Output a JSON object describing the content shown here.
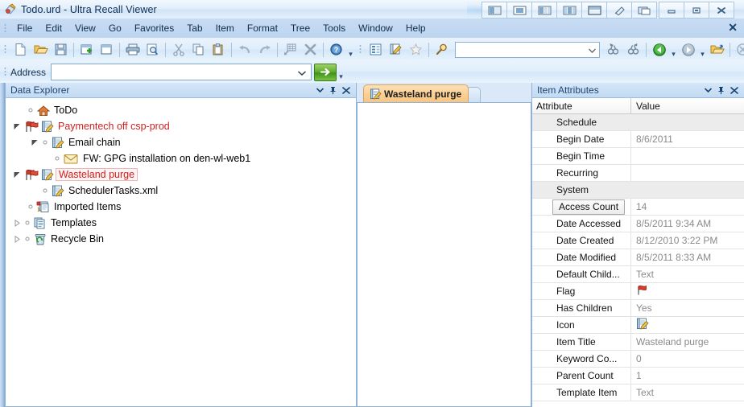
{
  "window": {
    "title": "Todo.urd - Ultra Recall Viewer",
    "app_icon": "ultra-recall-icon",
    "layout_buttons": [
      "layout-split-left",
      "layout-center",
      "layout-split-right",
      "layout-three-pane",
      "layout-horizontal",
      "layout-pin",
      "layout-float"
    ],
    "controls": {
      "minimize": "minimize-icon",
      "restore": "restore-icon",
      "close": "close-icon"
    }
  },
  "menu": {
    "items": [
      "File",
      "Edit",
      "View",
      "Go",
      "Favorites",
      "Tab",
      "Item",
      "Format",
      "Tree",
      "Tools",
      "Window",
      "Help"
    ],
    "close_label": "✕"
  },
  "toolbar": {
    "group1": [
      "new-document-icon",
      "open-folder-icon",
      "save-icon",
      "new-item-icon",
      "new-child-item-icon",
      "print-icon",
      "print-preview-icon",
      "cut-icon",
      "copy-icon",
      "paste-icon",
      "undo-icon",
      "redo-icon",
      "insert-item-icon",
      "delete-icon",
      "help-icon"
    ],
    "group2": [
      "outline-view-icon",
      "edit-note-icon",
      "favorites-star-icon",
      "find-icon"
    ],
    "search": {
      "value": "",
      "placeholder": ""
    },
    "group3": [
      "find-previous-icon",
      "find-next-icon",
      "back-icon",
      "back-dropdown-icon",
      "forward-icon",
      "forward-dropdown-icon",
      "go-up-folder-icon",
      "stop-icon",
      "refresh-icon",
      "view-mode-icon",
      "view-mode-dropdown-icon",
      "properties-grid-icon"
    ]
  },
  "address": {
    "label": "Address",
    "value": "",
    "placeholder": "",
    "dropdown_icon": "chevron-down-icon",
    "go_icon": "go-arrow-icon"
  },
  "explorer": {
    "title": "Data Explorer",
    "tools": [
      "chevron-down-icon",
      "pin-icon",
      "close-icon"
    ],
    "nodes": [
      {
        "label": "ToDo",
        "indent": 0,
        "icon": "home-icon",
        "expander": "none",
        "color": "normal",
        "selected": false,
        "dot": true
      },
      {
        "label": "Paymentech off csp-prod",
        "indent": 0,
        "icon": "note-edit-icon",
        "expander": "expanded",
        "color": "red",
        "selected": false,
        "dot": false,
        "flag": true
      },
      {
        "label": "Email chain",
        "indent": 1,
        "icon": "note-edit-icon",
        "expander": "expanded",
        "color": "normal",
        "selected": false,
        "dot": true
      },
      {
        "label": "FW: GPG installation on den-wl-web1",
        "indent": 2,
        "icon": "envelope-icon",
        "expander": "none",
        "color": "normal",
        "selected": false,
        "dot": true
      },
      {
        "label": "Wasteland purge",
        "indent": 0,
        "icon": "note-edit-icon",
        "expander": "expanded",
        "color": "red",
        "selected": true,
        "dot": false,
        "flag": true
      },
      {
        "label": "SchedulerTasks.xml",
        "indent": 1,
        "icon": "note-edit-icon",
        "expander": "none",
        "color": "normal",
        "selected": false,
        "dot": true
      },
      {
        "label": "Imported Items",
        "indent": 0,
        "icon": "imported-items-icon",
        "expander": "none",
        "color": "normal",
        "selected": false,
        "dot": true
      },
      {
        "label": "Templates",
        "indent": 0,
        "icon": "templates-icon",
        "expander": "collapsed",
        "color": "normal",
        "selected": false,
        "dot": true
      },
      {
        "label": "Recycle Bin",
        "indent": 0,
        "icon": "recycle-bin-icon",
        "expander": "collapsed",
        "color": "normal",
        "selected": false,
        "dot": true
      }
    ]
  },
  "document": {
    "tabs": [
      {
        "label": "Wasteland purge",
        "icon": "note-edit-icon",
        "active": true
      }
    ],
    "content": ""
  },
  "attributes": {
    "title": "Item Attributes",
    "tools": [
      "chevron-down-icon",
      "pin-icon",
      "close-icon"
    ],
    "columns": [
      "Attribute",
      "Value"
    ],
    "rows": [
      {
        "name": "Schedule",
        "value": "",
        "group": true,
        "selected": false
      },
      {
        "name": "Begin Date",
        "value": "8/6/2011",
        "group": false,
        "selected": false
      },
      {
        "name": "Begin Time",
        "value": "",
        "group": false,
        "selected": false
      },
      {
        "name": "Recurring",
        "value": "",
        "group": false,
        "selected": false
      },
      {
        "name": "System",
        "value": "",
        "group": true,
        "selected": false
      },
      {
        "name": "Access Count",
        "value": "14",
        "group": false,
        "selected": true
      },
      {
        "name": "Date Accessed",
        "value": "8/5/2011 9:34 AM",
        "group": false,
        "selected": false
      },
      {
        "name": "Date Created",
        "value": "8/12/2010 3:22 PM",
        "group": false,
        "selected": false
      },
      {
        "name": "Date Modified",
        "value": "8/5/2011 8:33 AM",
        "group": false,
        "selected": false
      },
      {
        "name": "Default Child...",
        "value": "Text",
        "group": false,
        "selected": false
      },
      {
        "name": "Flag",
        "value": "",
        "group": false,
        "selected": false,
        "icon": "red-flag-icon"
      },
      {
        "name": "Has Children",
        "value": "Yes",
        "group": false,
        "selected": false
      },
      {
        "name": "Icon",
        "value": "",
        "group": false,
        "selected": false,
        "icon": "note-edit-icon"
      },
      {
        "name": "Item Title",
        "value": "Wasteland purge",
        "group": false,
        "selected": false
      },
      {
        "name": "Keyword Co...",
        "value": "0",
        "group": false,
        "selected": false
      },
      {
        "name": "Parent Count",
        "value": "1",
        "group": false,
        "selected": false
      },
      {
        "name": "Template Item",
        "value": "Text",
        "group": false,
        "selected": false
      }
    ]
  },
  "colors": {
    "title_bar": "#e2eefb",
    "menu_bar": "#c2d9f1",
    "accent_red": "#d02020",
    "tab_active": "#fbcf93",
    "panel_header": "#c9ddf4",
    "group_row": "#ececec",
    "value_text": "#8a8a8a"
  }
}
